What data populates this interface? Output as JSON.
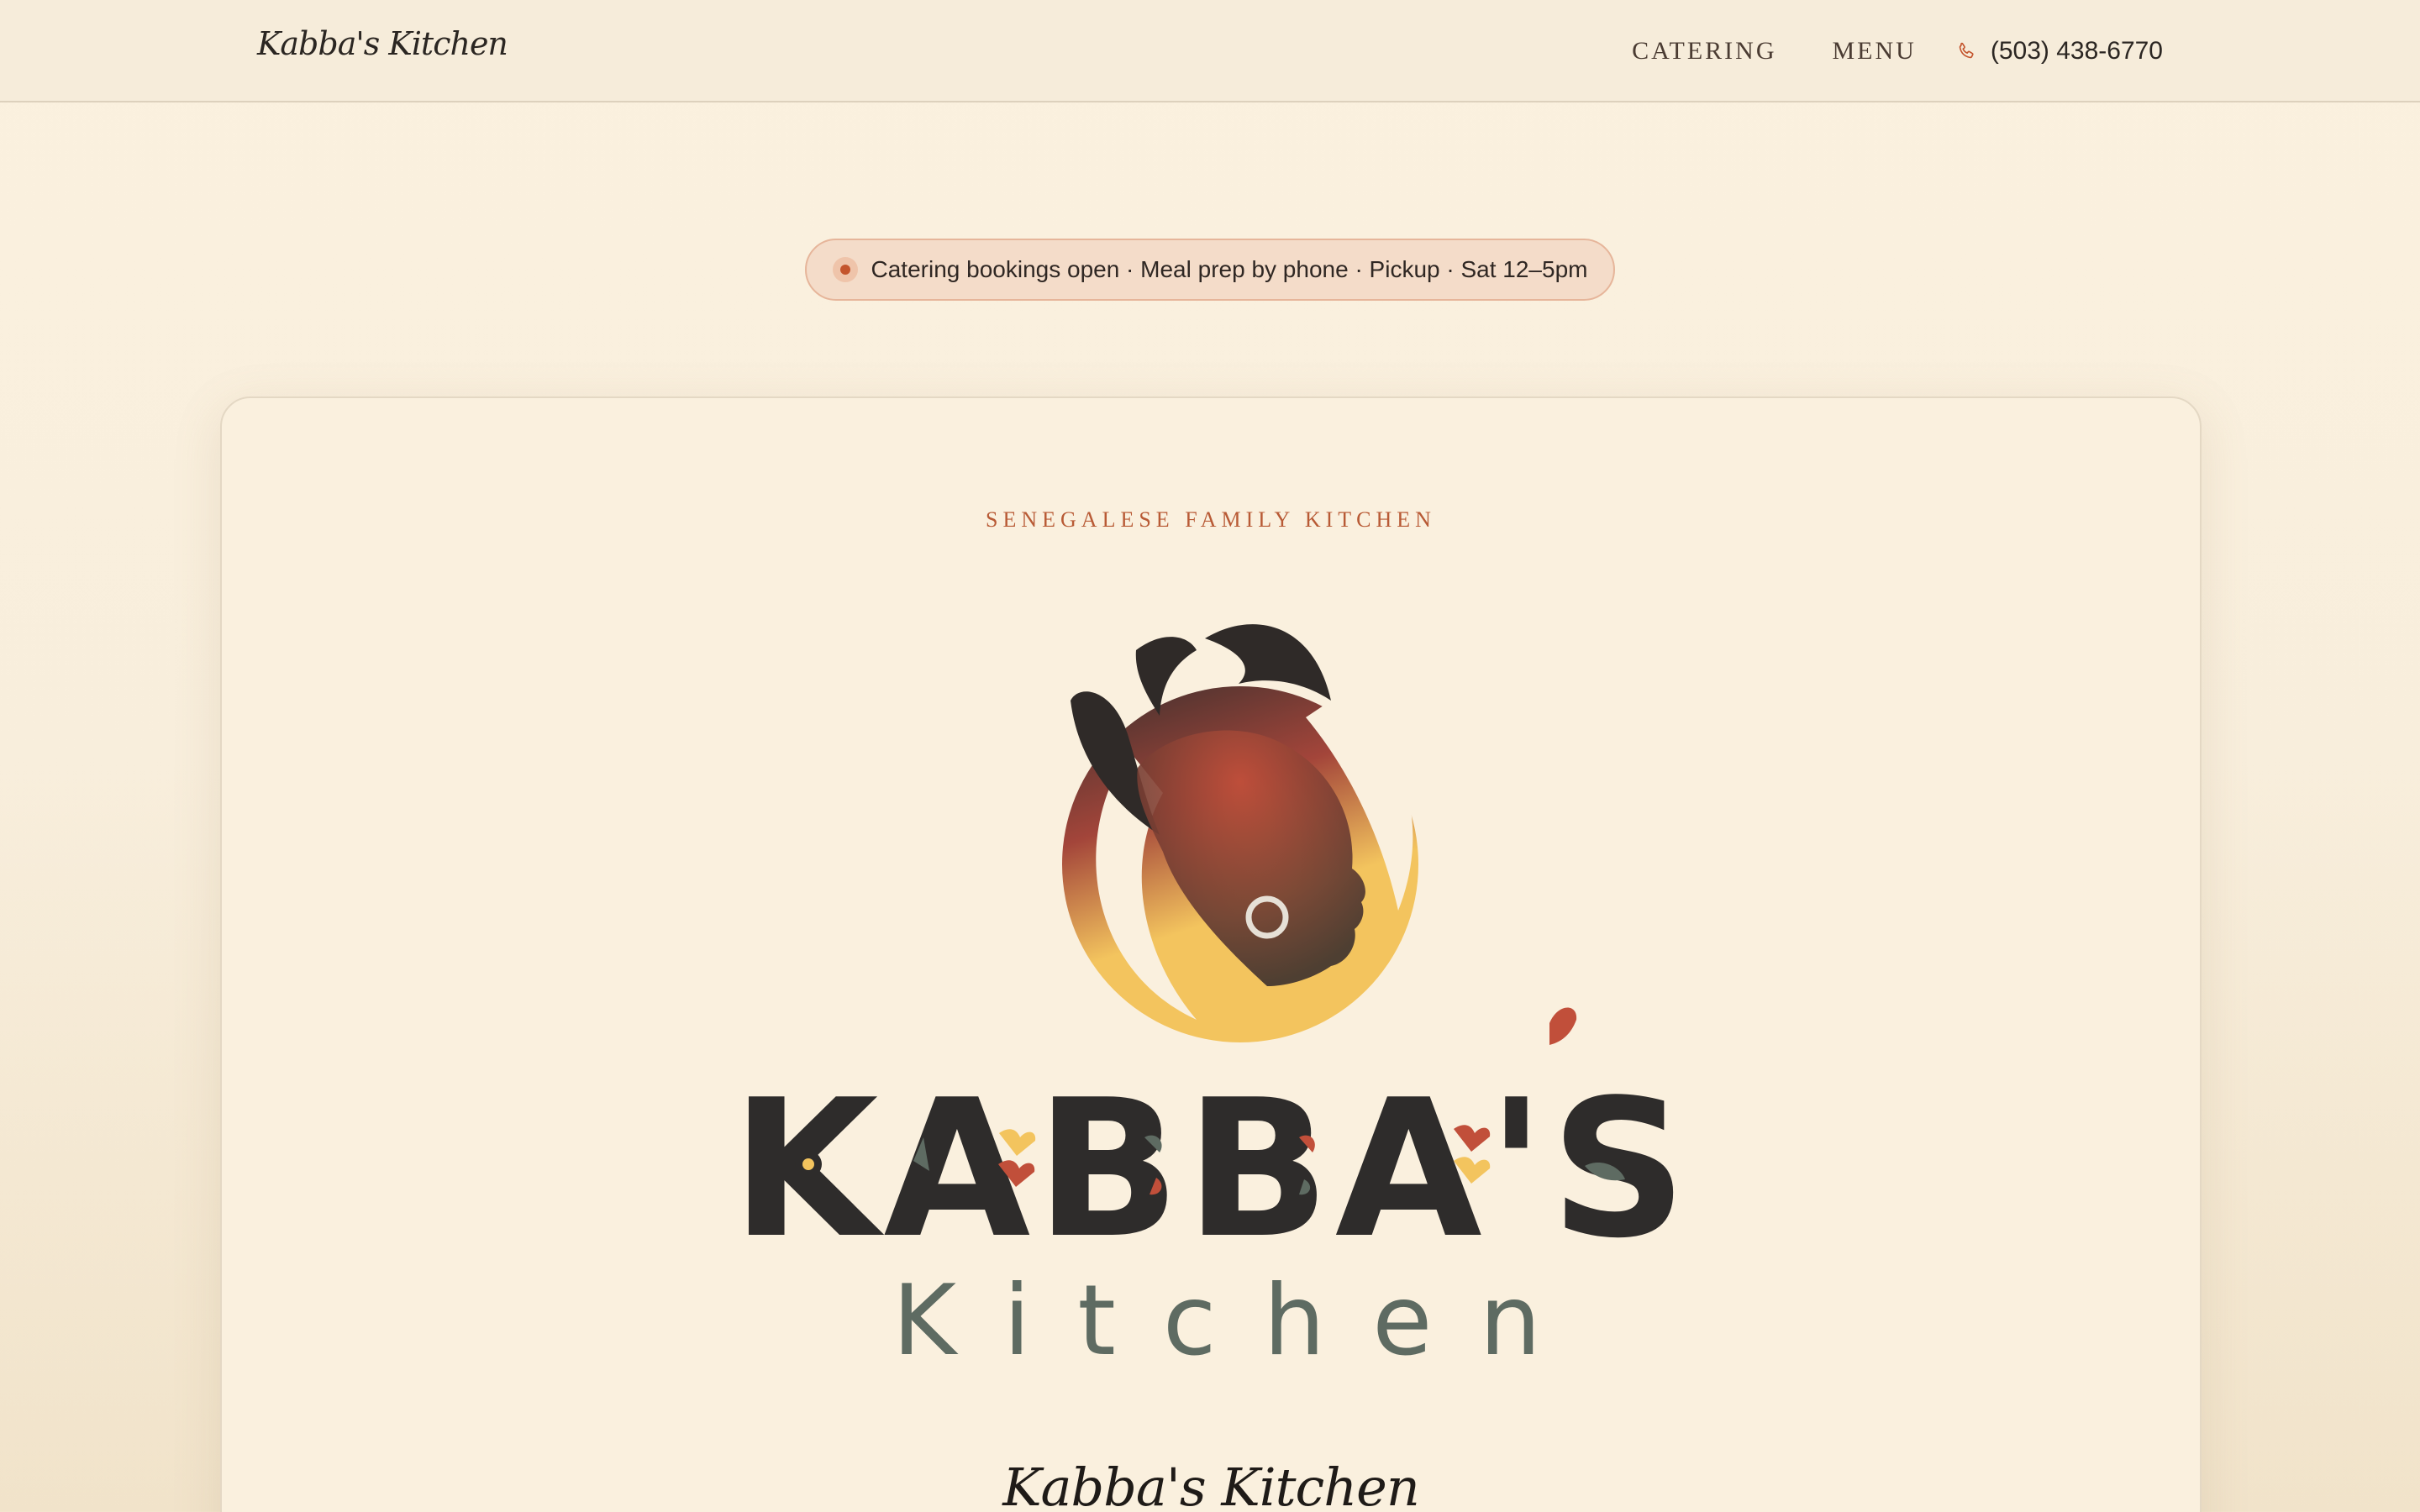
{
  "header": {
    "brand": "Kabba's Kitchen",
    "nav": [
      {
        "label": "CATERING"
      },
      {
        "label": "MENU"
      }
    ],
    "phone": "(503) 438-6770"
  },
  "announcement": {
    "text": "Catering bookings open · Meal prep by phone · Pickup · Sat 12–5pm"
  },
  "hero": {
    "eyebrow": "SENEGALESE FAMILY KITCHEN",
    "logo_wordmark": "KABBA'S",
    "logo_subword": "Kitchen",
    "script_title": "Kabba's Kitchen"
  },
  "colors": {
    "accent": "#c4542c",
    "ink": "#2b2622",
    "gold": "#f3c45e",
    "sage": "#5e6b62"
  }
}
